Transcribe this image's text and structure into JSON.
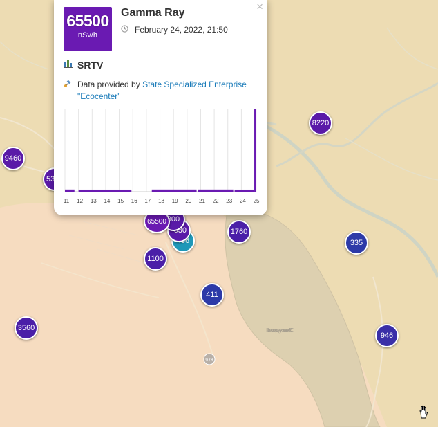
{
  "popup": {
    "value": "65500",
    "unit": "nSv/h",
    "title": "Gamma Ray",
    "date": "February 24, 2022, 21:50",
    "station": "SRTV",
    "provider_prefix": "Data provided by ",
    "provider_link_line1": "State Specialized Enterprise",
    "provider_link_line2": "\"Ecocenter\"",
    "close": "×",
    "accent_color": "#6a1ab2"
  },
  "map": {
    "labels": [
      "Велике охолоджуюче ставок ЧАЕС",
      "978"
    ],
    "markers": [
      {
        "label": "9460",
        "color": "#5a1aa8"
      },
      {
        "label": "53",
        "color": "#5a1aa8"
      },
      {
        "label": "8220",
        "color": "#5a1aa8"
      },
      {
        "label": "1760",
        "color": "#4a1fa8"
      },
      {
        "label": "335",
        "color": "#2d3aa8"
      },
      {
        "label": "1100",
        "color": "#4a1fa8"
      },
      {
        "label": "411",
        "color": "#2d3aa8"
      },
      {
        "label": "3560",
        "color": "#4a1fa8"
      },
      {
        "label": "946",
        "color": "#3a2fa8"
      },
      {
        "label": "436",
        "color": "#1f98b8"
      },
      {
        "label": "630",
        "color": "#5a1aa8"
      },
      {
        "label": "800",
        "color": "#5a1aa8"
      },
      {
        "label": "65500",
        "color": "#6a1ab2"
      }
    ]
  },
  "chart_data": {
    "type": "bar",
    "x_ticks": [
      "11",
      "12",
      "13",
      "14",
      "15",
      "16",
      "17",
      "18",
      "19",
      "20",
      "21",
      "22",
      "23",
      "24",
      "25"
    ],
    "xlim": [
      11,
      25.1
    ],
    "series": [
      {
        "color": "#6a1ab2",
        "segments": [
          {
            "start": 11.0,
            "end": 11.7,
            "value": 1.8
          },
          {
            "start": 12.0,
            "end": 15.9,
            "value": 1.7
          },
          {
            "start": 17.4,
            "end": 20.7,
            "value": 1.8
          },
          {
            "start": 20.8,
            "end": 23.4,
            "value": 1.8
          },
          {
            "start": 23.5,
            "end": 24.9,
            "value": 1.7
          }
        ],
        "spike": {
          "x": 25.0,
          "value": 100
        }
      }
    ]
  },
  "icons": {
    "clock": "clock-icon",
    "station": "station-icon",
    "provider": "satellite-icon",
    "cursor": "hand-cursor-icon"
  }
}
